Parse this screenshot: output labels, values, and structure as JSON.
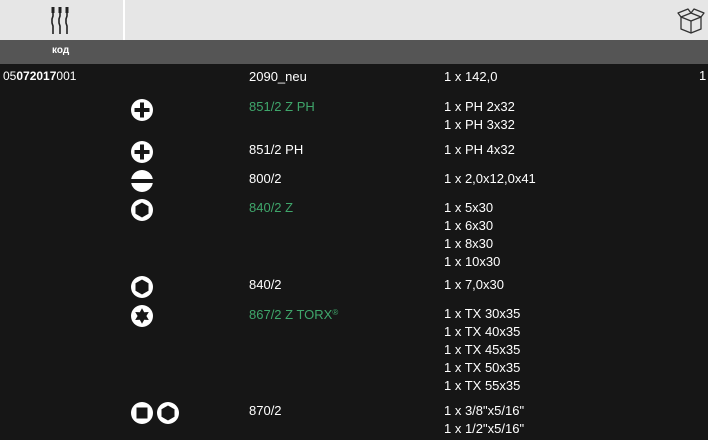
{
  "header": {
    "tools_icon": "screwdriver-bits-icon",
    "packaging_icon": "box-icon",
    "column_label": "код"
  },
  "product": {
    "article_prefix": "05",
    "article_bold": "072017",
    "article_suffix": "001",
    "quantity": "1"
  },
  "rows": [
    {
      "icon": "",
      "name": "2090_neu",
      "green": false,
      "specs": [
        "1 x 142,0"
      ]
    },
    {
      "icon": "phillips-icon",
      "name": "851/2 Z PH",
      "green": true,
      "specs": [
        "1 x PH 2x32",
        "1 x PH 3x32"
      ]
    },
    {
      "icon": "phillips-icon",
      "name": "851/2 PH",
      "green": false,
      "specs": [
        "1 x PH 4x32"
      ]
    },
    {
      "icon": "slotted-icon",
      "name": "800/2",
      "green": false,
      "specs": [
        "1 x 2,0x12,0x41"
      ]
    },
    {
      "icon": "hex-socket-icon",
      "name": "840/2 Z",
      "green": true,
      "specs": [
        "1 x 5x30",
        "1 x 6x30",
        "1 x 8x30",
        "1 x 10x30"
      ]
    },
    {
      "icon": "hex-socket-icon",
      "name": "840/2",
      "green": false,
      "specs": [
        "1 x 7,0x30"
      ]
    },
    {
      "icon": "torx-icon",
      "name": "867/2 Z TORX",
      "name_sup": "®",
      "green": true,
      "specs": [
        "1 x TX 30x35",
        "1 x TX 40x35",
        "1 x TX 45x35",
        "1 x TX 50x35",
        "1 x TX 55x35"
      ]
    },
    {
      "icon": "square-hex-icon",
      "name": "870/2",
      "green": false,
      "specs": [
        "1 x 3/8\"x5/16\"",
        "1 x 1/2\"x5/16\""
      ]
    }
  ],
  "colors": {
    "background": "#161616",
    "topbar": "#e6e6e6",
    "headbar": "#555555",
    "green_text": "#3fa66b"
  }
}
